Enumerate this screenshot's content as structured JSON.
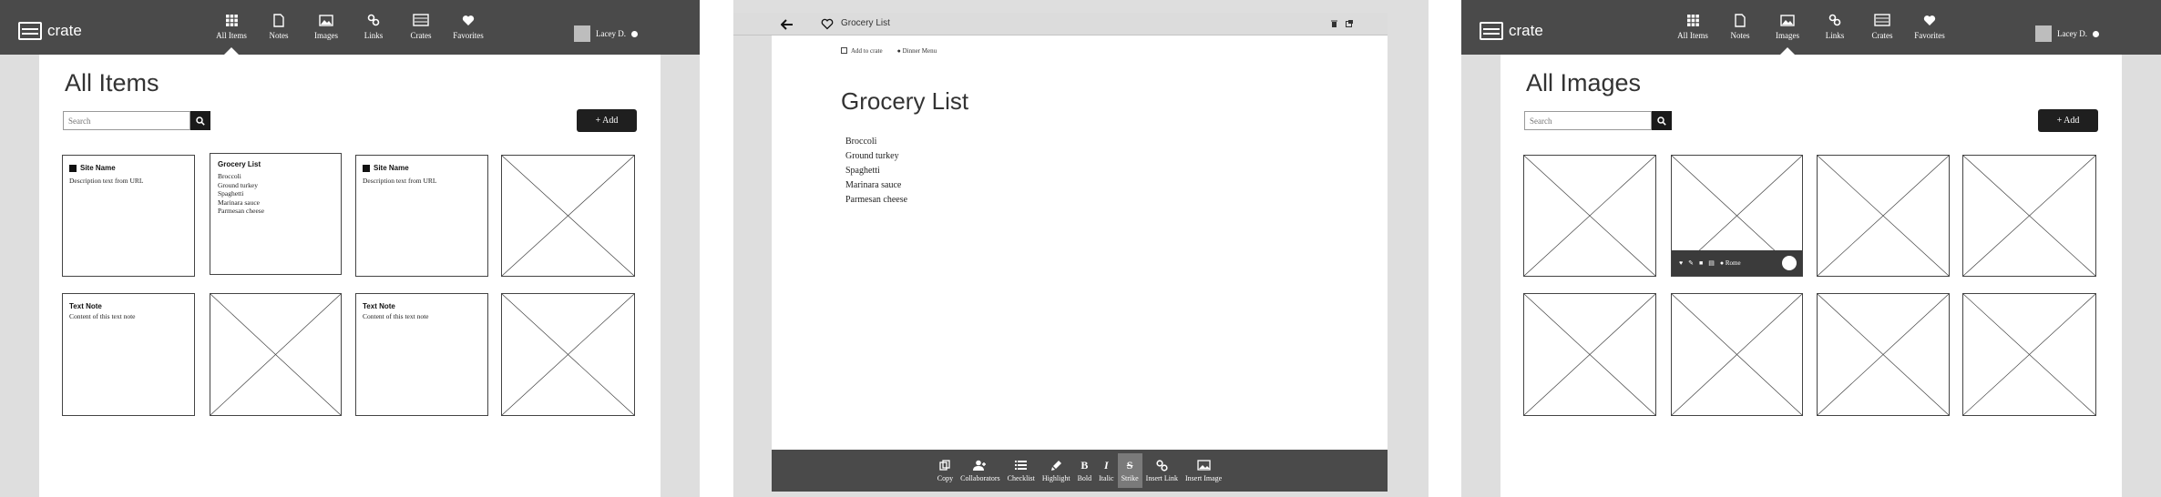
{
  "app": {
    "logo_text": "crate"
  },
  "nav": [
    {
      "label": "All Items",
      "icon": "grid-icon"
    },
    {
      "label": "Notes",
      "icon": "note-icon"
    },
    {
      "label": "Images",
      "icon": "image-icon"
    },
    {
      "label": "Links",
      "icon": "link-icon"
    },
    {
      "label": "Crates",
      "icon": "crate-icon"
    },
    {
      "label": "Favorites",
      "icon": "heart-icon"
    }
  ],
  "user": {
    "name": "Lacey D."
  },
  "all_items": {
    "title": "All Items",
    "search_placeholder": "Search",
    "add_label": "+ Add",
    "cards": [
      {
        "title": "Site Name",
        "desc": "Description text from URL"
      },
      {
        "title": "Grocery List",
        "items": [
          "Broccoli",
          "Ground turkey",
          "Spaghetti",
          "Marinara sauce",
          "Parmesan cheese"
        ]
      },
      {
        "title": "Site Name",
        "desc": "Description text from URL"
      },
      {
        "title": "Text Note",
        "desc": "Content of this text note"
      },
      {
        "title": "Text Note",
        "desc": "Content of this text note"
      }
    ]
  },
  "editor": {
    "header_title": "Grocery List",
    "add_to_crate": "Add to crate",
    "tag": "Dinner Menu",
    "title": "Grocery List",
    "items": [
      "Broccoli",
      "Ground turkey",
      "Spaghetti",
      "Marinara sauce",
      "Parmesan cheese"
    ],
    "toolbar": [
      {
        "label": "Copy",
        "icon": "copy-icon"
      },
      {
        "label": "Collaborators",
        "icon": "collaborators-icon"
      },
      {
        "label": "Checklist",
        "icon": "checklist-icon"
      },
      {
        "label": "Highlight",
        "icon": "highlight-icon"
      },
      {
        "label": "Bold",
        "icon": "bold-icon",
        "glyph": "B"
      },
      {
        "label": "Italic",
        "icon": "italic-icon",
        "glyph": "I"
      },
      {
        "label": "Strike",
        "icon": "strike-icon",
        "glyph": "S",
        "active": true
      },
      {
        "label": "Insert Link",
        "icon": "link-icon"
      },
      {
        "label": "Insert Image",
        "icon": "image-icon"
      }
    ]
  },
  "all_images": {
    "title": "All Images",
    "search_placeholder": "Search",
    "add_label": "+ Add",
    "overlay_tag": "Rome"
  },
  "colors": {
    "nav_bg": "#4a4a4a",
    "button_bg": "#1f1f1f",
    "side_gray": "#dedede"
  }
}
